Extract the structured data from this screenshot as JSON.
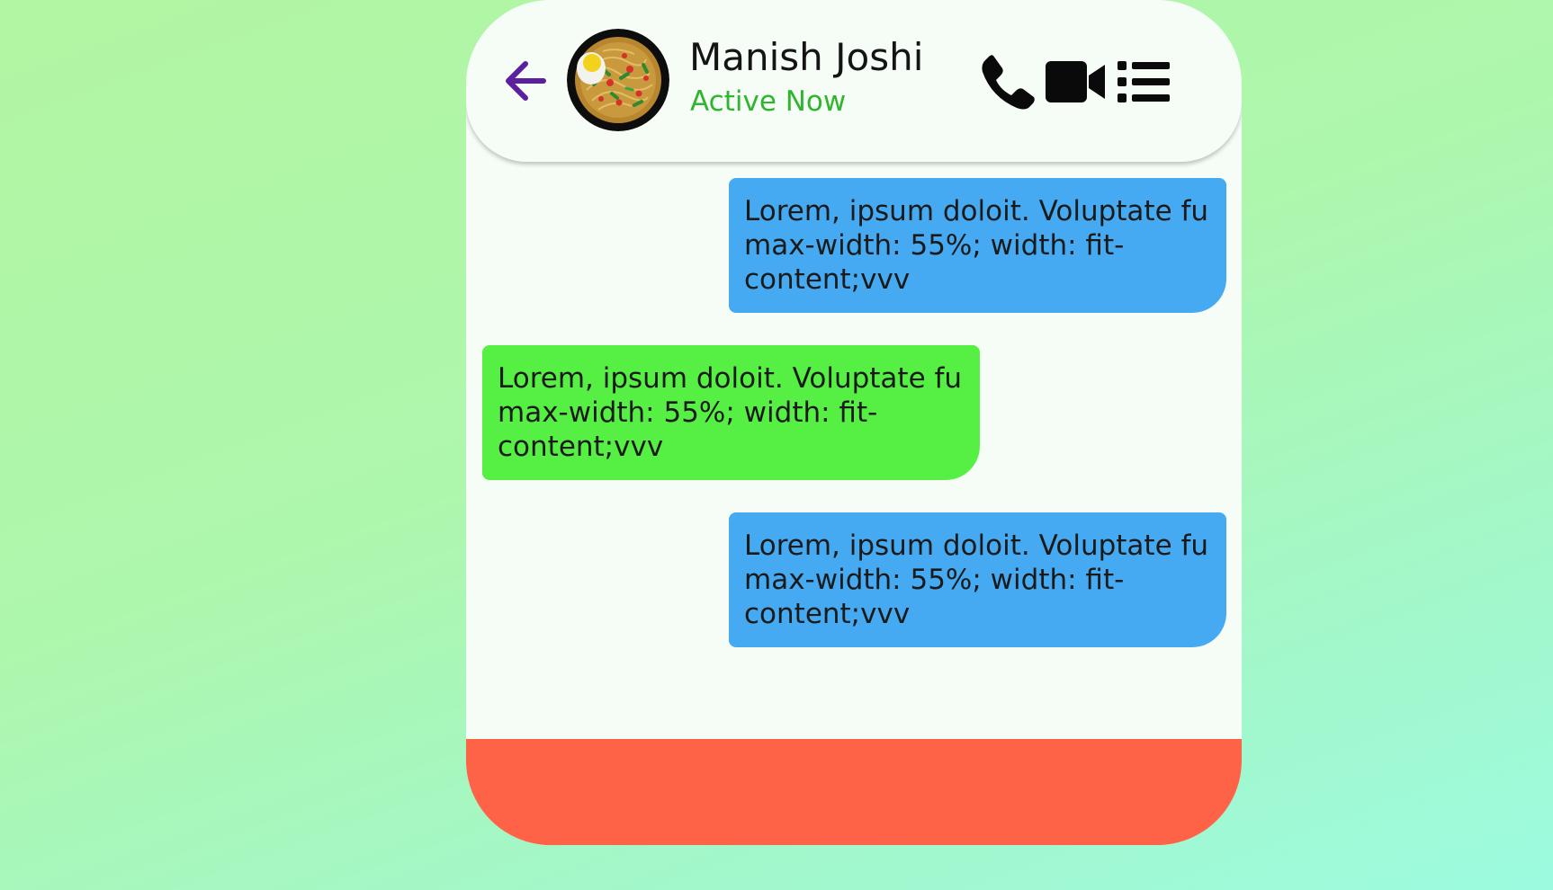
{
  "header": {
    "contact_name": "Manish Joshi",
    "status": "Active Now"
  },
  "icons": {
    "back": "arrow-left-icon",
    "avatar": "food-bowl-avatar",
    "call": "phone-icon",
    "video": "video-camera-icon",
    "menu": "list-icon"
  },
  "messages": [
    {
      "direction": "sent",
      "text": "Lorem, ipsum doloit. Voluptate fu max-width: 55%; width: fit-content;vvv"
    },
    {
      "direction": "received",
      "text": "Lorem, ipsum doloit. Voluptate fu max-width: 55%; width: fit-content;vvv"
    },
    {
      "direction": "sent",
      "text": "Lorem, ipsum doloit. Voluptate fu max-width: 55%; width: fit-content;vvv"
    }
  ],
  "input": {
    "value": "",
    "placeholder": ""
  },
  "colors": {
    "sent_bubble": "#45aaf2",
    "received_bubble": "#56ef44",
    "status_text": "#2fb52f",
    "back_arrow": "#5b1fa0",
    "input_bar": "#ff6347"
  }
}
